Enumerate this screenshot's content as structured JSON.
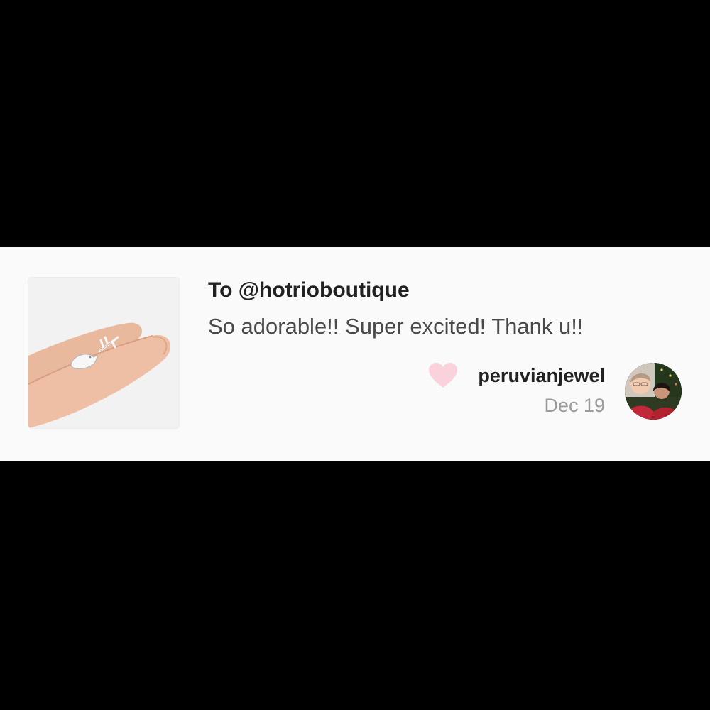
{
  "review": {
    "recipient": "To @hotrioboutique",
    "message": "So adorable!! Super excited! Thank u!!",
    "reviewer": "peruvianjewel",
    "date": "Dec 19",
    "heart_icon": "heart-icon",
    "heart_color": "#f9d2db"
  },
  "colors": {
    "background": "#000000",
    "card": "#fafafa",
    "title_text": "#222222",
    "body_text": "#4a4a4a",
    "date_text": "#9a9a9a"
  }
}
